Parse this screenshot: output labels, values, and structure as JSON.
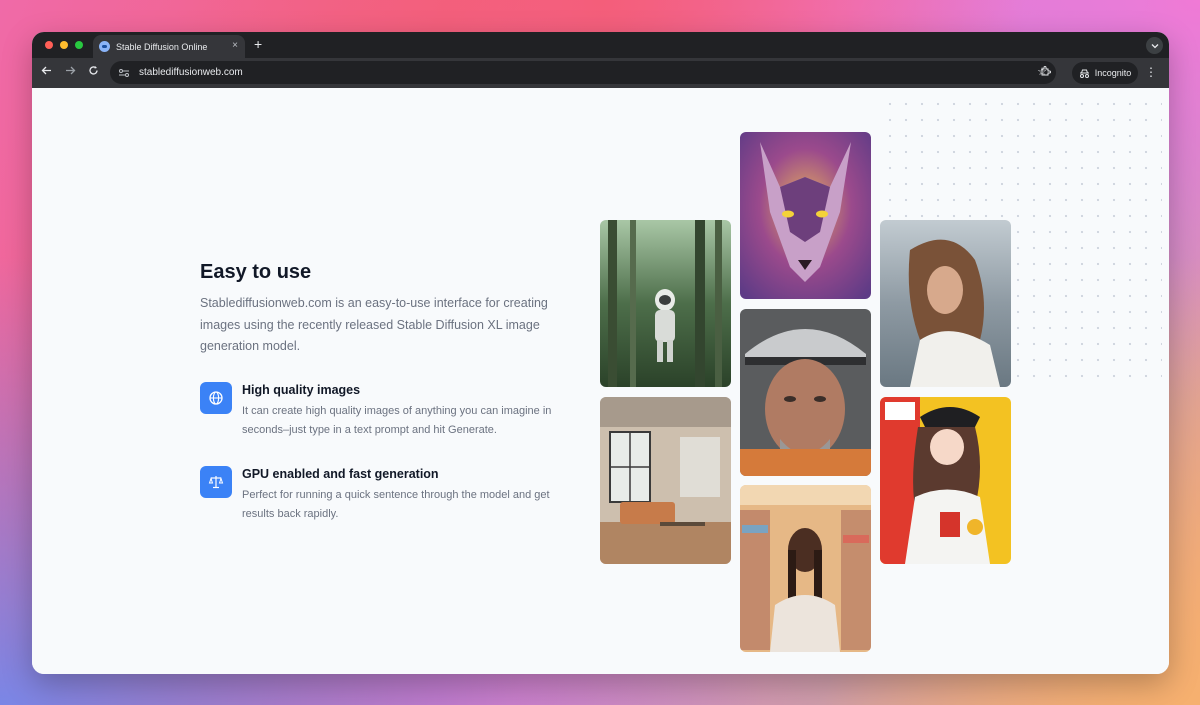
{
  "browser": {
    "tab_title": "Stable Diffusion Online",
    "tab_close": "×",
    "new_tab": "+",
    "url": "stablediffusionweb.com",
    "profile_label": "Incognito"
  },
  "main": {
    "headline": "Easy to use",
    "intro": "Stablediffusionweb.com is an easy-to-use interface for creating images using the recently released Stable Diffusion XL image generation model.",
    "features": [
      {
        "icon": "globe-icon",
        "title": "High quality images",
        "description": "It can create high quality images of anything you can imagine in seconds–just type in a text prompt and hit Generate."
      },
      {
        "icon": "scale-icon",
        "title": "GPU enabled and fast generation",
        "description": "Perfect for running a quick sentence through the model and get results back rapidly."
      }
    ]
  },
  "gallery": [
    {
      "name": "astronaut-forest-image"
    },
    {
      "name": "interior-room-image"
    },
    {
      "name": "wolf-art-image"
    },
    {
      "name": "miner-portrait-image"
    },
    {
      "name": "woman-store-image"
    },
    {
      "name": "woman-sea-image"
    },
    {
      "name": "anime-girl-image"
    }
  ],
  "colors": {
    "accent": "#3b82f6",
    "headline": "#111827",
    "body_text": "#6b7280",
    "page_bg": "#f8fafc"
  }
}
